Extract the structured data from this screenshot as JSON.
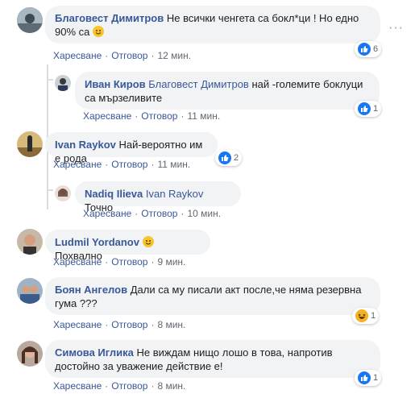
{
  "colors": {
    "link": "#385898",
    "bubble": "#f2f3f5",
    "meta": "#606770",
    "like": "#1877f2",
    "haha": "#f7b125",
    "thread_line": "#dadde1"
  },
  "actions": {
    "like": "Харесване",
    "reply": "Отговор"
  },
  "comments": [
    {
      "author": "Благовест Димитров",
      "text": "Не всички ченгета са бокл*ци ! Но едно 90% са",
      "emoji": "smile-emoji",
      "time": "12 мин.",
      "reaction_count": "6",
      "reaction": "like-icon"
    },
    {
      "author": "Иван Киров",
      "mention": "Благовест Димитров",
      "text": "най -големите боклуци са мързеливите",
      "time": "11 мин.",
      "reaction_count": "1",
      "reaction": "like-icon"
    },
    {
      "author": "Ivan Raykov",
      "text": "Най-вероятно им е рода",
      "time": "11 мин.",
      "reaction_count": "2",
      "reaction": "like-icon"
    },
    {
      "author": "Nadiq Ilieva",
      "mention": "Ivan Raykov",
      "text": "Точно",
      "time": "10 мин."
    },
    {
      "author": "Ludmil Yordanov",
      "emoji": "smile-emoji",
      "text": "Похвално",
      "time": "9 мин."
    },
    {
      "author": "Боян Ангелов",
      "text": "Дали са му писали акт после,че няма резервна гума ???",
      "time": "8 мин.",
      "reaction_count": "1",
      "reaction": "haha-icon"
    },
    {
      "author": "Симова Иглика",
      "text": "Не виждам нищо лошо в това, напротив достойно за уважение действие е!",
      "time": "8 мин.",
      "reaction_count": "1",
      "reaction": "like-icon"
    }
  ]
}
